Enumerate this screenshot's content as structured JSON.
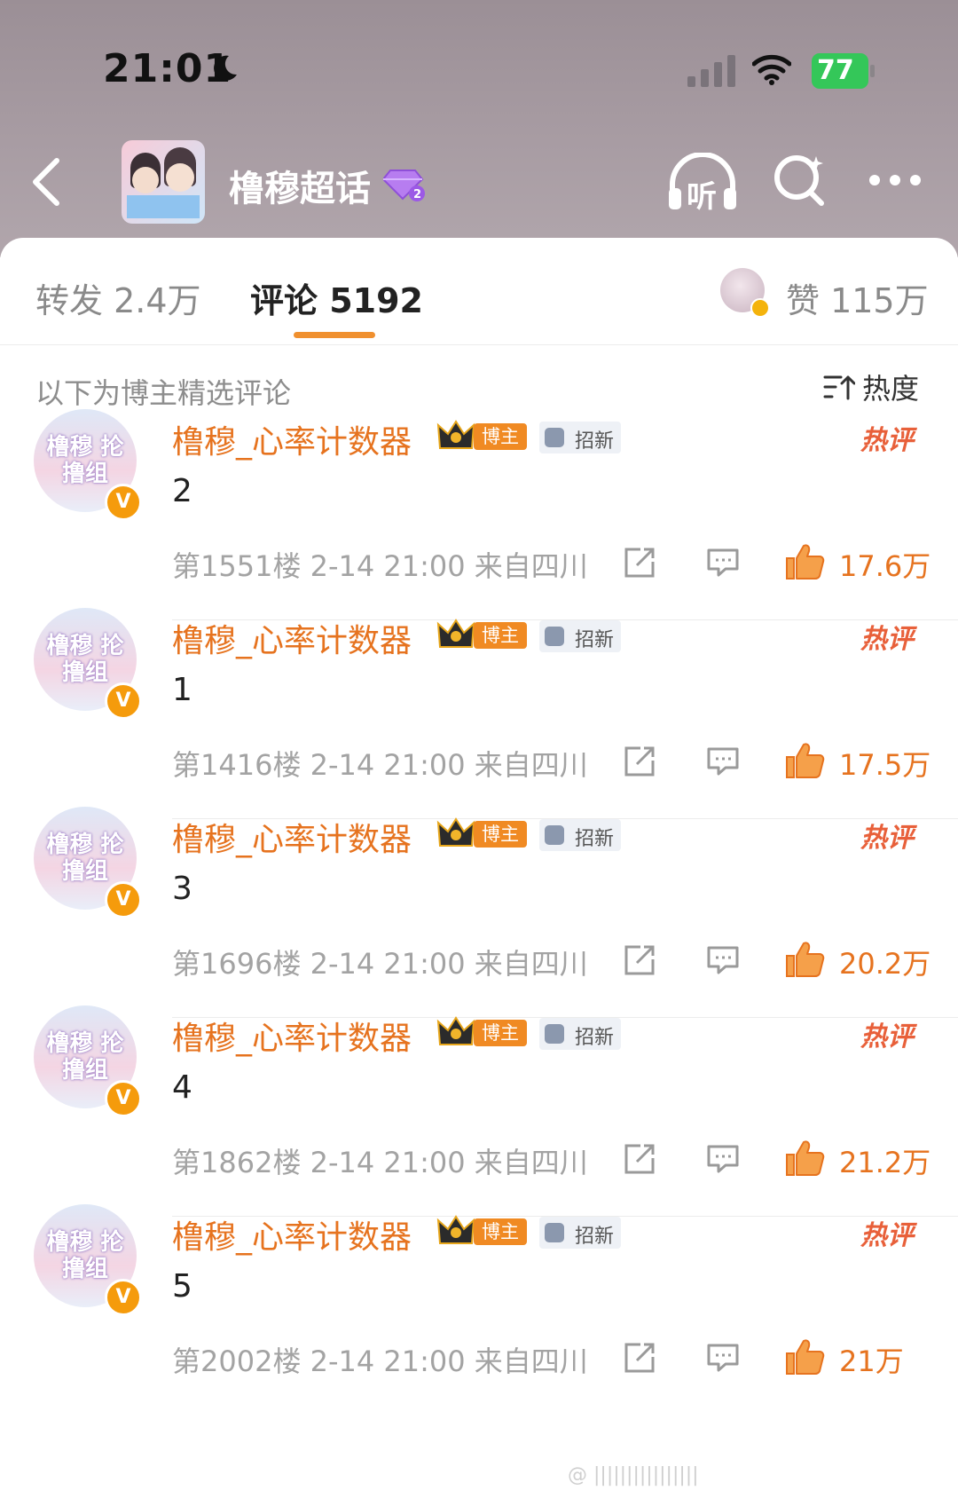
{
  "status_bar": {
    "time": "21:01",
    "battery": "77"
  },
  "header": {
    "title": "橹穆超话",
    "listen_label": "听"
  },
  "tabs": {
    "repost": "转发 2.4万",
    "comment": "评论 5192",
    "likes": "赞 115万"
  },
  "section": {
    "label": "以下为博主精选评论",
    "sort_label": "热度"
  },
  "comments": [
    {
      "username": "橹穆_心率计数器",
      "host_badge": "博主",
      "recruit_badge": "招新",
      "hot_tag": "热评",
      "text": "2",
      "meta": "第1551楼 2-14 21:00 来自四川",
      "likes": "17.6万"
    },
    {
      "username": "橹穆_心率计数器",
      "host_badge": "博主",
      "recruit_badge": "招新",
      "hot_tag": "热评",
      "text": "1",
      "meta": "第1416楼 2-14 21:00 来自四川",
      "likes": "17.5万"
    },
    {
      "username": "橹穆_心率计数器",
      "host_badge": "博主",
      "recruit_badge": "招新",
      "hot_tag": "热评",
      "text": "3",
      "meta": "第1696楼 2-14 21:00 来自四川",
      "likes": "20.2万"
    },
    {
      "username": "橹穆_心率计数器",
      "host_badge": "博主",
      "recruit_badge": "招新",
      "hot_tag": "热评",
      "text": "4",
      "meta": "第1862楼 2-14 21:00 来自四川",
      "likes": "21.2万"
    },
    {
      "username": "橹穆_心率计数器",
      "host_badge": "博主",
      "recruit_badge": "招新",
      "hot_tag": "热评",
      "text": "5",
      "meta": "第2002楼 2-14 21:00 来自四川",
      "likes": "21万"
    }
  ],
  "avatar_text": "橹穆 抡撸组",
  "colors": {
    "accent": "#e6731f",
    "tab_underline": "#f0902f",
    "battery": "#34c759"
  }
}
